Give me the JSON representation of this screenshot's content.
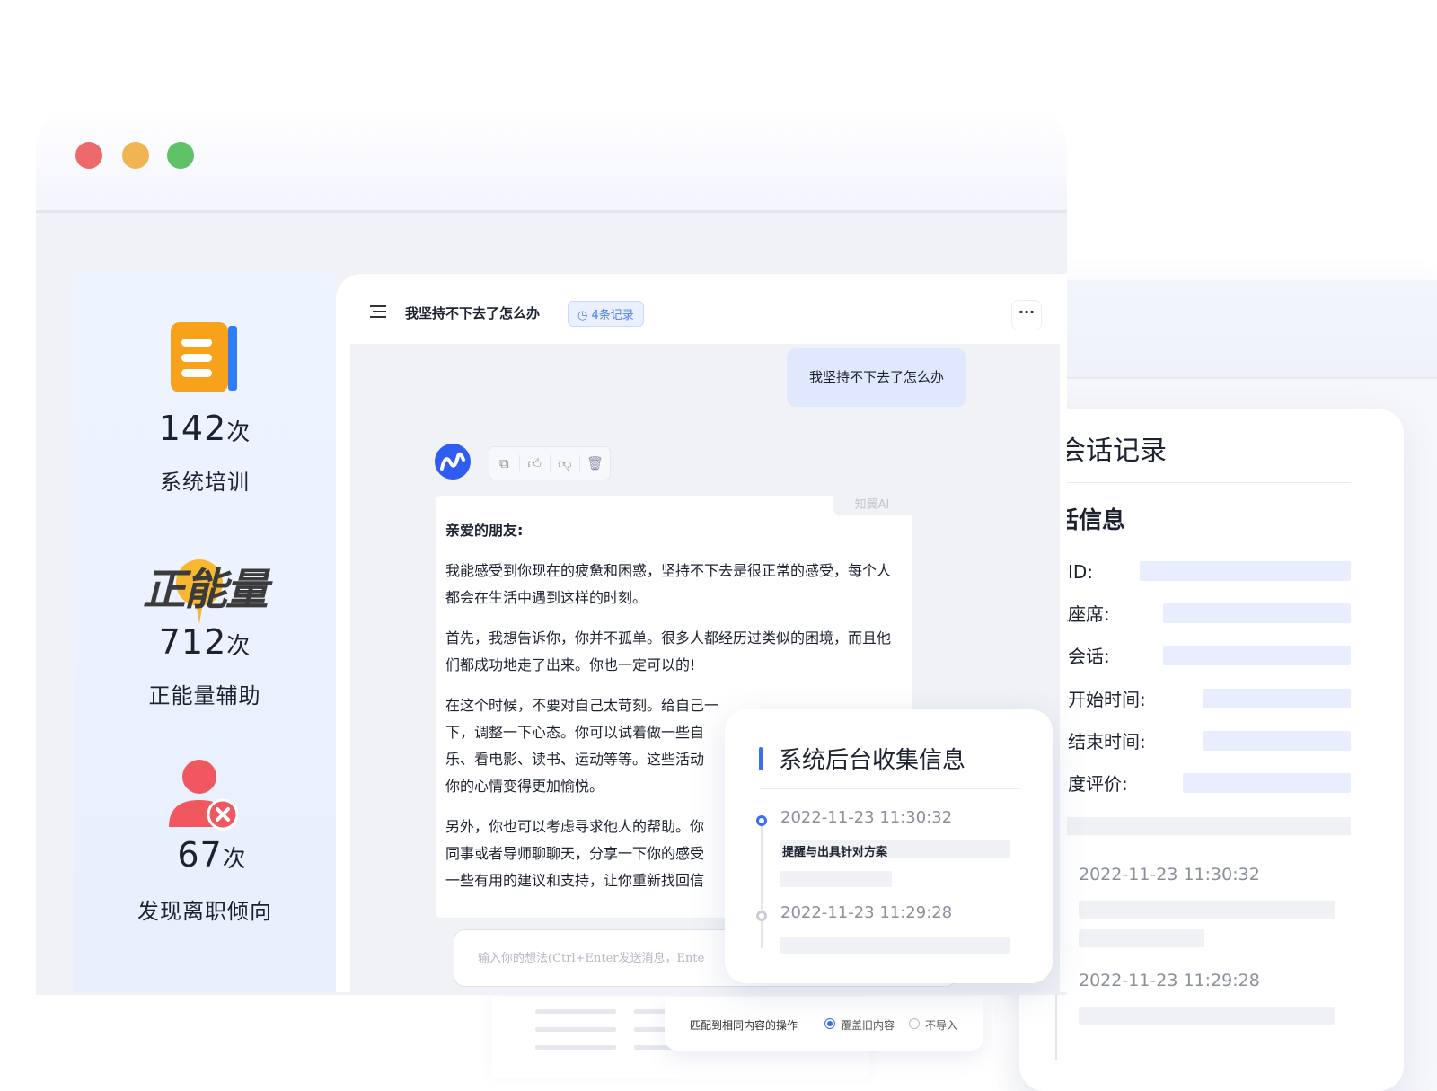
{
  "window": {
    "traffic_lights": {
      "red": "#ec6a6a",
      "yellow": "#f0b552",
      "green": "#5ec267"
    }
  },
  "stats": [
    {
      "value": "142",
      "unit": "次",
      "label": "系统培训"
    },
    {
      "value": "712",
      "unit": "次",
      "label": "正能量辅助",
      "logo_text": "正能量"
    },
    {
      "value": "67",
      "unit": "次",
      "label": "发现离职倾向"
    }
  ],
  "chat": {
    "title": "我坚持不下去了怎么办",
    "records_badge": "4条记录",
    "user_message": "我坚持不下去了怎么办",
    "ai_label": "知翼AI",
    "paragraphs": [
      "亲爱的朋友:",
      "我能感受到你现在的疲惫和困惑，坚持不下去是很正常的感受，每个人都会在生活中遇到这样的时刻。",
      "首先，我想告诉你，你并不孤单。很多人都经历过类似的困境，而且他们都成功地走了出来。你也一定可以的!",
      "在这个时候，不要对自己太苛刻。给自己一",
      "下，调整一下心态。你可以试着做一些自",
      "乐、看电影、读书、运动等等。这些活动",
      "你的心情变得更加愉悦。",
      "另外，你也可以考虑寻求他人的帮助。你",
      "同事或者导师聊聊天，分享一下你的感受",
      "一些有用的建议和支持，让你重新找回信"
    ],
    "input_placeholder": "输入你的想法(Ctrl+Enter发送消息，Ente"
  },
  "backend": {
    "title": "系统后台收集信息",
    "timeline": [
      {
        "time": "2022-11-23  11:30:32",
        "text": "提醒与出具针对方案"
      },
      {
        "time": "2022-11-23  11:29:28",
        "text": ""
      }
    ]
  },
  "record_panel": {
    "title": "会话记录",
    "section": "对话信息",
    "fields": [
      "对话ID:",
      "受理座席:",
      "转移会话:",
      "会话开始时间:",
      "会话结束时间:",
      "满意度评价:"
    ],
    "timeline": [
      "2022-11-23  11:30:32",
      "2022-11-23  11:29:28"
    ]
  },
  "import_bar": {
    "label": "匹配到相同内容的操作",
    "option_overwrite": "覆盖旧内容",
    "option_skip": "不导入"
  },
  "colors": {
    "accent": "#3b6ef6",
    "brand_orange": "#f7a21a"
  }
}
